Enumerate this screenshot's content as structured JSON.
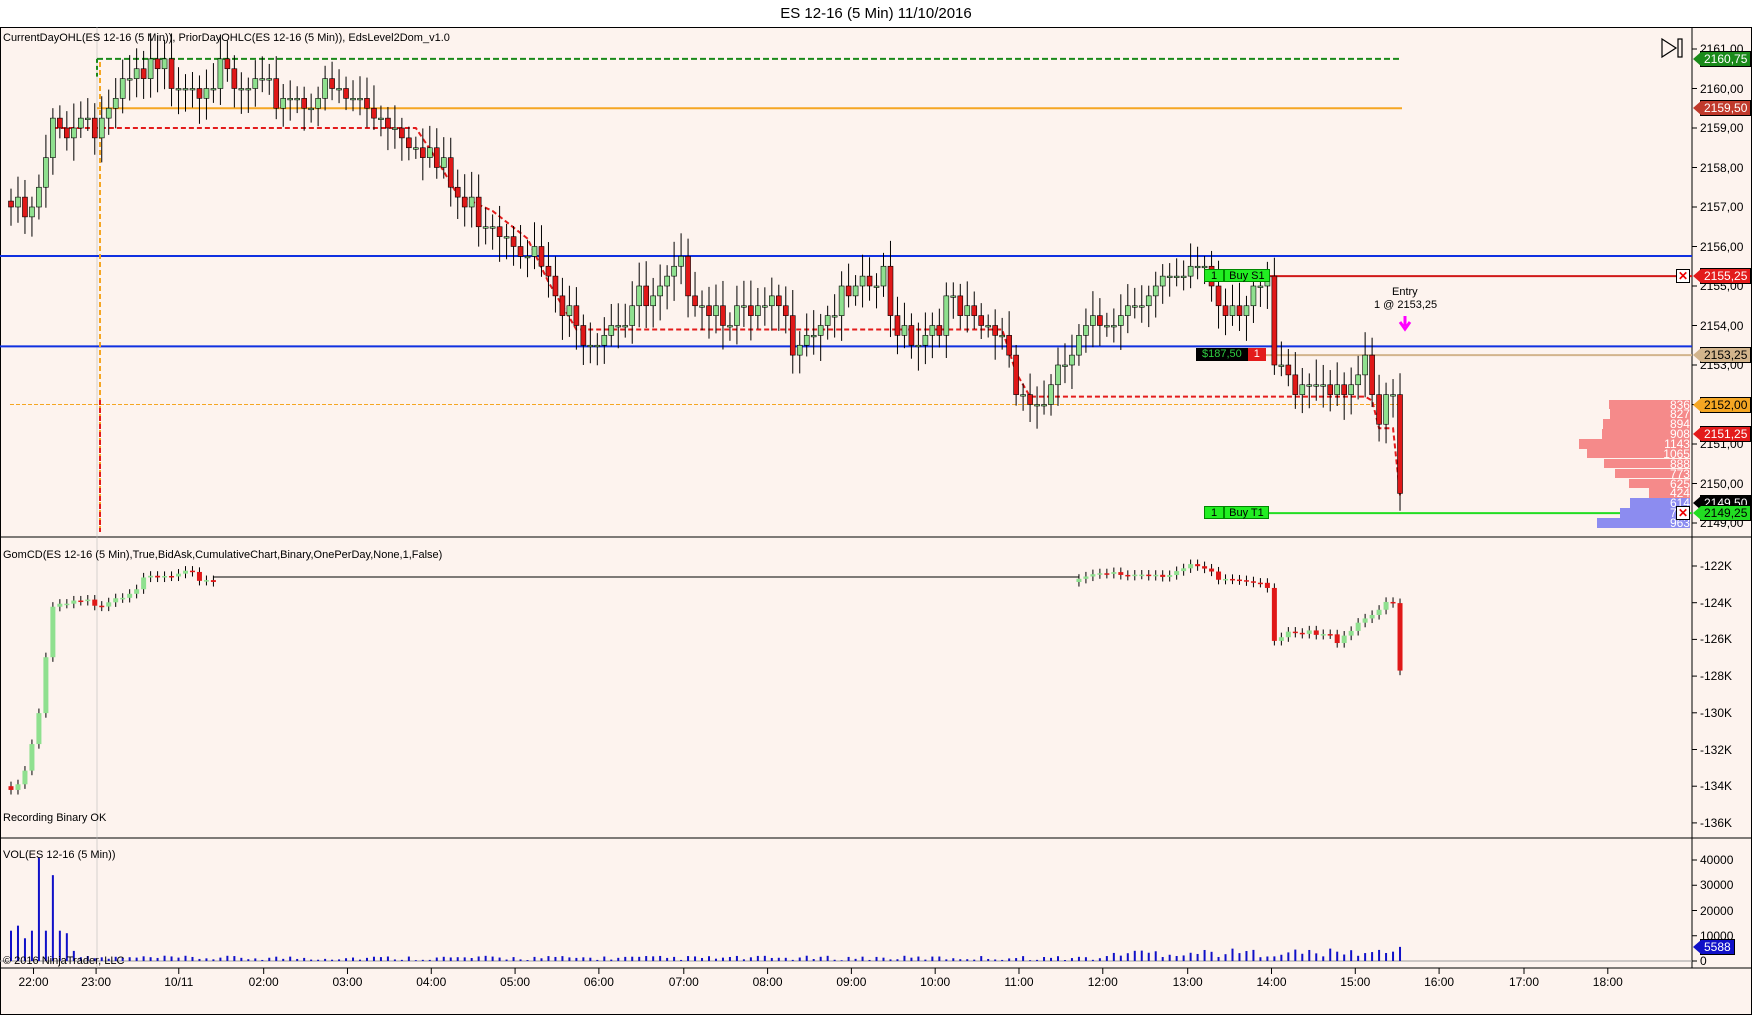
{
  "title": "ES 12-16 (5 Min)  11/10/2016",
  "panels": {
    "price_label": "CurrentDayOHL(ES 12-16 (5 Min)), PriorDayOHLC(ES 12-16 (5 Min)), EdsLevel2Dom_v1.0",
    "delta_label": "GomCD(ES 12-16 (5 Min),True,BidAsk,CumulativeChart,Binary,OnePerDay,None,1,False)",
    "delta_status": "Recording Binary OK",
    "volume_label": "VOL(ES 12-16 (5 Min))",
    "copyright": "© 2016 NinjaTrader, LLC"
  },
  "price_axis": [
    "2161,00",
    "2160,00",
    "2159,00",
    "2158,00",
    "2157,00",
    "2156,00",
    "2155,00",
    "2154,00",
    "2153,00",
    "2152,00",
    "2151,00",
    "2150,00",
    "2149,00"
  ],
  "price_tags": [
    {
      "text": "2160,75",
      "price": 2160.75,
      "bg": "#1a8a1a",
      "fg": "#ffffff"
    },
    {
      "text": "2159,50",
      "price": 2159.5,
      "bg": "#c0392b",
      "fg": "#ffffff"
    },
    {
      "text": "2155,25",
      "price": 2155.25,
      "bg": "#e31b1b",
      "fg": "#ffffff"
    },
    {
      "text": "2153,25",
      "price": 2153.25,
      "bg": "#d2b48c",
      "fg": "#000000"
    },
    {
      "text": "2152,00",
      "price": 2152.0,
      "bg": "#f5a623",
      "fg": "#000000"
    },
    {
      "text": "2151,25",
      "price": 2151.25,
      "bg": "#e31b1b",
      "fg": "#ffffff"
    },
    {
      "text": "2149,50",
      "price": 2149.5,
      "bg": "#000000",
      "fg": "#ffffff"
    },
    {
      "text": "2149,25",
      "price": 2149.25,
      "bg": "#22dd22",
      "fg": "#000000"
    }
  ],
  "delta_axis": [
    "-122K",
    "-124K",
    "-126K",
    "-128K",
    "-130K",
    "-132K",
    "-134K",
    "-136K"
  ],
  "volume_axis": [
    "40000",
    "30000",
    "20000",
    "10000",
    "0"
  ],
  "volume_tag": "5588",
  "time_axis": [
    "22:00",
    "23:00",
    "10/11",
    "02:00",
    "03:00",
    "04:00",
    "05:00",
    "06:00",
    "07:00",
    "08:00",
    "09:00",
    "10:00",
    "11:00",
    "12:00",
    "13:00",
    "14:00",
    "15:00",
    "16:00",
    "17:00",
    "18:00"
  ],
  "orders": {
    "stop": {
      "qty": "1",
      "label": "Buy S1",
      "price": 2155.25
    },
    "target": {
      "qty": "1",
      "label": "Buy T1",
      "price": 2149.25
    },
    "position": {
      "pnl": "$187,50",
      "qty": "1",
      "price": 2153.25
    },
    "entry": {
      "title": "Entry",
      "detail": "1 @ 2153,25"
    }
  },
  "levels": {
    "current_high": 2160.75,
    "prior_close": 2159.5,
    "blue_upper": 2155.76,
    "blue_lower": 2153.47,
    "prior_low": 2152.0
  },
  "dom": {
    "asks": [
      {
        "price": 2152.0,
        "size": "836"
      },
      {
        "price": 2151.75,
        "size": "827"
      },
      {
        "price": 2151.5,
        "size": "894"
      },
      {
        "price": 2151.25,
        "size": "908"
      },
      {
        "price": 2151.0,
        "size": "1143"
      },
      {
        "price": 2150.75,
        "size": "1065"
      },
      {
        "price": 2150.5,
        "size": "888"
      },
      {
        "price": 2150.25,
        "size": "773"
      },
      {
        "price": 2150.0,
        "size": "625"
      },
      {
        "price": 2149.75,
        "size": "424"
      }
    ],
    "bids": [
      {
        "price": 2149.5,
        "size": "614"
      },
      {
        "price": 2149.25,
        "size": "720"
      },
      {
        "price": 2149.0,
        "size": "963"
      }
    ]
  },
  "chart_data": {
    "type": "candlestick",
    "price_waypoints": [
      [
        0,
        2157.15
      ],
      [
        3,
        2156.9
      ],
      [
        6,
        2159.1
      ],
      [
        8,
        2159.4
      ],
      [
        13,
        2159.55
      ],
      [
        18,
        2160.4
      ],
      [
        22,
        2160.6
      ],
      [
        29,
        2160.6
      ],
      [
        33,
        2160.1
      ],
      [
        40,
        2160.1
      ],
      [
        46,
        2160.2
      ],
      [
        51,
        2159.7
      ],
      [
        54,
        2159.55
      ],
      [
        58,
        2159.1
      ],
      [
        61,
        2158.3
      ],
      [
        64,
        2157.4
      ],
      [
        69,
        2157.0
      ],
      [
        74,
        2156.3
      ],
      [
        77,
        2155.2
      ],
      [
        81,
        2154.0
      ],
      [
        86,
        2154.5
      ],
      [
        93,
        2154.9
      ],
      [
        96,
        2155.5
      ],
      [
        101,
        2154.8
      ],
      [
        106,
        2154.3
      ],
      [
        110,
        2154.6
      ],
      [
        112,
        2154.0
      ],
      [
        117,
        2154.6
      ],
      [
        122,
        2155.0
      ],
      [
        125,
        2155.4
      ],
      [
        126,
        2154.4
      ],
      [
        131,
        2154.0
      ],
      [
        134,
        2154.8
      ],
      [
        138,
        2154.1
      ],
      [
        142,
        2154.0
      ],
      [
        144,
        2152.9
      ],
      [
        146,
        2152.3
      ],
      [
        149,
        2152.6
      ],
      [
        152,
        2153.5
      ],
      [
        157,
        2154.5
      ],
      [
        163,
        2155.3
      ],
      [
        168,
        2155.2
      ],
      [
        171,
        2155.9
      ],
      [
        173,
        2154.75
      ],
      [
        178,
        2155.2
      ],
      [
        180,
        2154.9
      ],
      [
        181,
        2152.9
      ],
      [
        184,
        2152.6
      ],
      [
        188,
        2152.9
      ],
      [
        190,
        2152.9
      ],
      [
        194,
        2152.9
      ],
      [
        196,
        2151.5
      ],
      [
        198,
        2152.5
      ],
      [
        199,
        2149.8
      ]
    ],
    "delta_waypoints_k": [
      [
        0,
        -134
      ],
      [
        2,
        -133
      ],
      [
        4,
        -130
      ],
      [
        6,
        -124.2
      ],
      [
        8,
        -124
      ],
      [
        13,
        -123.8
      ],
      [
        20,
        -122.6
      ],
      [
        25,
        -122.4
      ],
      [
        29,
        -122.6
      ],
      [
        153,
        -122.6
      ],
      [
        160,
        -122.3
      ],
      [
        165,
        -122.2
      ],
      [
        170,
        -122.0
      ],
      [
        173,
        -122.6
      ],
      [
        178,
        -122.5
      ],
      [
        180,
        -122.8
      ],
      [
        181,
        -125.8
      ],
      [
        186,
        -125.6
      ],
      [
        190,
        -125.8
      ],
      [
        195,
        -124.3
      ],
      [
        198,
        -124.0
      ],
      [
        199,
        -127.7
      ]
    ],
    "price_ylim": [
      2148.75,
      2161.25
    ],
    "delta_ylim_k": [
      -136.5,
      -121.5
    ],
    "volume_ylim": [
      0,
      45000
    ],
    "last_volume": 5588
  }
}
